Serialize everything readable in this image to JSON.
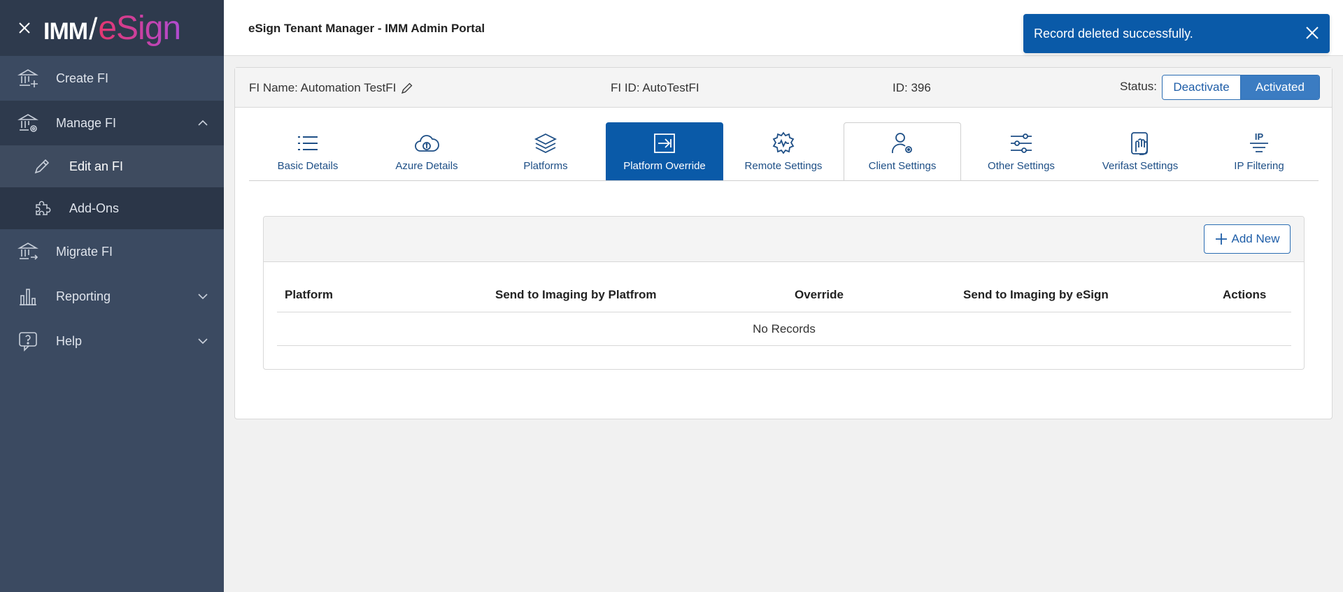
{
  "sidebar": {
    "logo": {
      "imm": "IMM",
      "slash": "/",
      "esign": "eSign"
    },
    "items": [
      {
        "label": "Create FI",
        "icon": "bank-plus-icon"
      },
      {
        "label": "Manage FI",
        "icon": "bank-gear-icon"
      },
      {
        "label": "Edit an FI",
        "icon": "pencil-icon"
      },
      {
        "label": "Add-Ons",
        "icon": "puzzle-icon"
      },
      {
        "label": "Migrate FI",
        "icon": "bank-arrow-icon"
      },
      {
        "label": "Reporting",
        "icon": "bar-chart-icon"
      },
      {
        "label": "Help",
        "icon": "question-bubble-icon"
      }
    ]
  },
  "header": {
    "title": "eSign Tenant Manager - IMM Admin Portal"
  },
  "toast": {
    "message": "Record deleted successfully."
  },
  "fi_info": {
    "name": "FI Name: Automation TestFI",
    "fi_id": "FI ID: AutoTestFI",
    "id": "ID: 396",
    "status_label": "Status:",
    "deactivate": "Deactivate",
    "activated": "Activated"
  },
  "tabs": [
    {
      "label": "Basic Details",
      "icon": "list-icon"
    },
    {
      "label": "Azure Details",
      "icon": "cloud-info-icon"
    },
    {
      "label": "Platforms",
      "icon": "layers-icon"
    },
    {
      "label": "Platform Override",
      "icon": "arrow-into-box-icon"
    },
    {
      "label": "Remote Settings",
      "icon": "gear-wave-icon"
    },
    {
      "label": "Client Settings",
      "icon": "user-gear-icon"
    },
    {
      "label": "Other Settings",
      "icon": "sliders-icon"
    },
    {
      "label": "Verifast Settings",
      "icon": "hand-phone-icon"
    },
    {
      "label": "IP Filtering",
      "icon": "ip-filter-icon"
    }
  ],
  "table": {
    "add_new": "Add New",
    "columns": [
      "Platform",
      "Send to Imaging by Platfrom",
      "Override",
      "Send to Imaging by eSign",
      "Actions"
    ],
    "empty_text": "No Records"
  },
  "colors": {
    "accent": "#0a5aa8",
    "sidebar": "#3b4a61",
    "sidebar_header": "#2e3a4d"
  }
}
